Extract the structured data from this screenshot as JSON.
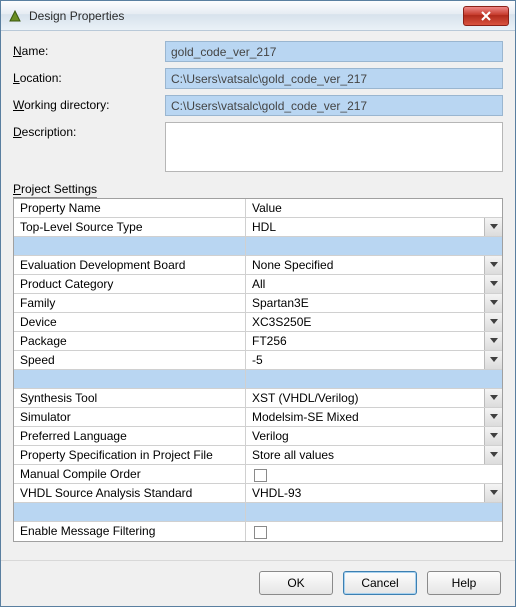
{
  "window": {
    "title": "Design Properties"
  },
  "labels": {
    "name": "Name:",
    "name_key": "N",
    "location": "Location:",
    "location_key": "L",
    "workdir": "Working directory:",
    "workdir_key": "W",
    "description": "Description:",
    "description_key": "D",
    "project_settings": "Project Settings",
    "project_settings_key": "P"
  },
  "fields": {
    "name": "gold_code_ver_217",
    "location": "C:\\Users\\vatsalc\\gold_code_ver_217",
    "workdir": "C:\\Users\\vatsalc\\gold_code_ver_217",
    "description": ""
  },
  "grid": {
    "header": {
      "prop": "Property Name",
      "val": "Value"
    },
    "rows": [
      {
        "prop": "Top-Level Source Type",
        "val": "HDL",
        "kind": "dd"
      },
      {
        "kind": "spacer"
      },
      {
        "prop": "Evaluation Development Board",
        "val": "None Specified",
        "kind": "dd"
      },
      {
        "prop": "Product Category",
        "val": "All",
        "kind": "dd"
      },
      {
        "prop": "Family",
        "val": "Spartan3E",
        "kind": "dd"
      },
      {
        "prop": "Device",
        "val": "XC3S250E",
        "kind": "dd"
      },
      {
        "prop": "Package",
        "val": "FT256",
        "kind": "dd"
      },
      {
        "prop": "Speed",
        "val": "-5",
        "kind": "dd"
      },
      {
        "kind": "spacer"
      },
      {
        "prop": "Synthesis Tool",
        "val": "XST (VHDL/Verilog)",
        "kind": "dd"
      },
      {
        "prop": "Simulator",
        "val": "Modelsim-SE Mixed",
        "kind": "dd"
      },
      {
        "prop": "Preferred Language",
        "val": "Verilog",
        "kind": "dd"
      },
      {
        "prop": "Property Specification in Project File",
        "val": "Store all values",
        "kind": "dd"
      },
      {
        "prop": "Manual Compile Order",
        "val": "",
        "kind": "chk",
        "checked": false
      },
      {
        "prop": "VHDL Source Analysis Standard",
        "val": "VHDL-93",
        "kind": "dd"
      },
      {
        "kind": "spacer"
      },
      {
        "prop": "Enable Message Filtering",
        "val": "",
        "kind": "chk",
        "checked": false
      }
    ]
  },
  "buttons": {
    "ok": "OK",
    "cancel": "Cancel",
    "help": "Help"
  }
}
